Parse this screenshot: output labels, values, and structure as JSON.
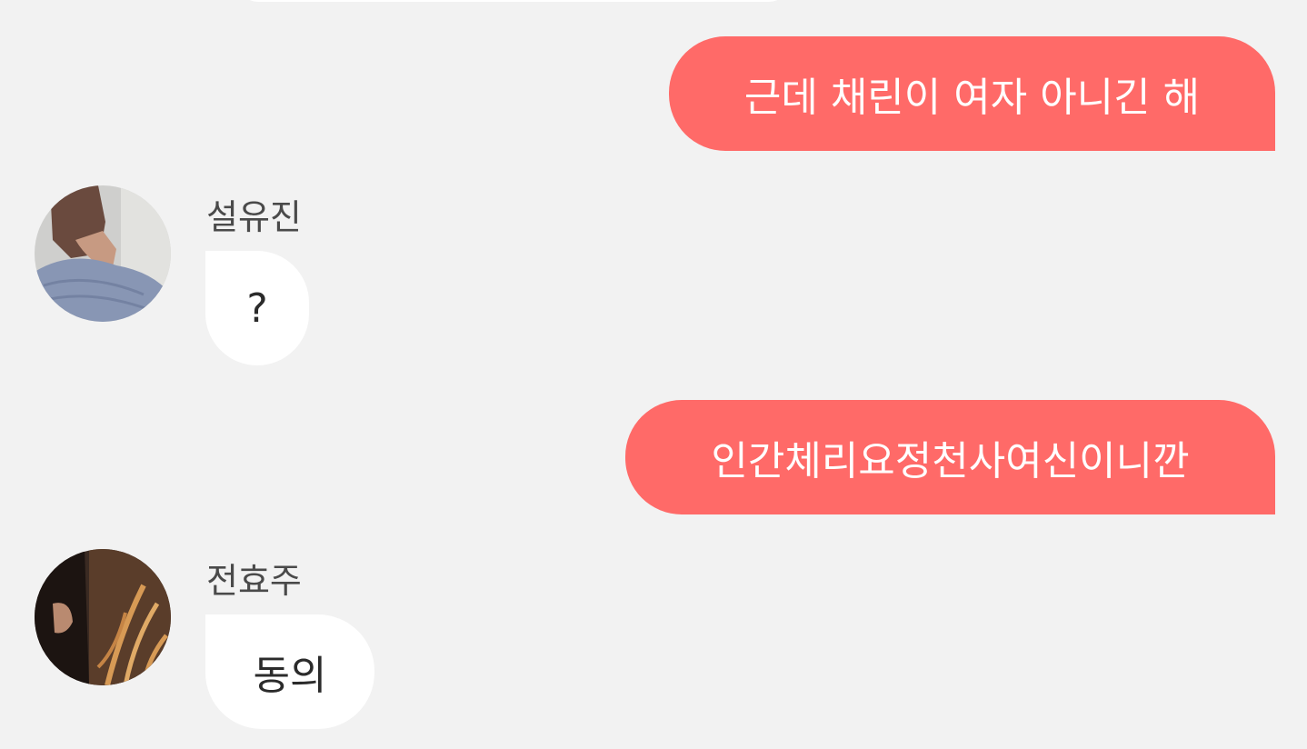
{
  "colors": {
    "background": "#f2f2f2",
    "outgoing_bubble": "#ff6a68",
    "incoming_bubble": "#ffffff"
  },
  "messages": [
    {
      "direction": "outgoing",
      "text": "근데 채린이 여자 아니긴 해"
    },
    {
      "direction": "incoming",
      "sender": "설유진",
      "avatar": "person-sweater-avatar",
      "text": "?"
    },
    {
      "direction": "outgoing",
      "text": "인간체리요정천사여신이니깐"
    },
    {
      "direction": "incoming",
      "sender": "전효주",
      "avatar": "person-hair-avatar",
      "text": "동의"
    }
  ]
}
